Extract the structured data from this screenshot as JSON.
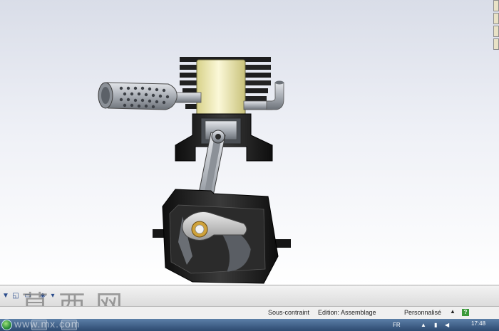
{
  "status": {
    "constraint": "Sous-contraint",
    "mode": "Edition: Assemblage",
    "units": "Personnalisé",
    "help": "?"
  },
  "taskbar": {
    "lang": "FR",
    "time": "17:48"
  },
  "watermark": {
    "chars": "莫西网",
    "url": "www.mx.com"
  },
  "toolbar": {
    "icons": [
      "filter-icon",
      "select-icon",
      "assembly-icon",
      "mate-icon",
      "explode-icon"
    ]
  },
  "colors": {
    "viewport_top": "#d9dde8",
    "cylinder": "#f3efb8",
    "housing": "#1c1c1c",
    "steel": "#a9aeb5",
    "taskbar": "#2d4a70"
  }
}
